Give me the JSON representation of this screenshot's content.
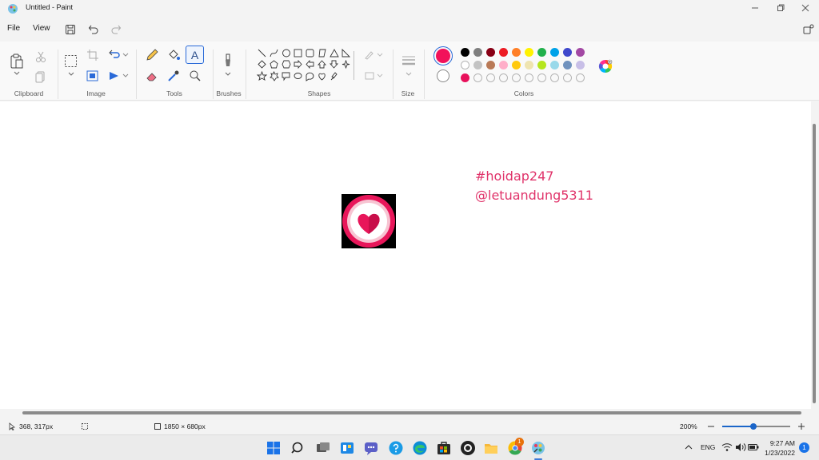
{
  "app": {
    "title": "Untitled - Paint"
  },
  "menu": {
    "file": "File",
    "view": "View"
  },
  "ribbon": {
    "groups": {
      "clipboard": "Clipboard",
      "image": "Image",
      "tools": "Tools",
      "brushes": "Brushes",
      "shapes": "Shapes",
      "size": "Size",
      "colors": "Colors"
    },
    "text_tool_glyph": "A"
  },
  "colors": {
    "primary": "#f2115a",
    "secondary": "#ffffff",
    "palette_row1": [
      "#000000",
      "#7f7f7f",
      "#880015",
      "#ed1c24",
      "#ff7f27",
      "#fff200",
      "#22b14c",
      "#00a2e8",
      "#3f48cc",
      "#a349a4"
    ],
    "palette_row2": [
      "#ffffff",
      "#c3c3c3",
      "#b97a57",
      "#ffaec9",
      "#ffc90e",
      "#efe4b0",
      "#b5e61d",
      "#99d9ea",
      "#7092be",
      "#c8bfe7"
    ],
    "palette_row3": [
      "#e8115b",
      "",
      "",
      "",
      "",
      "",
      "",
      "",
      "",
      ""
    ],
    "text_color": "#e0336a"
  },
  "canvas": {
    "line1": "#hoidap247",
    "line2": "@letuandung5311"
  },
  "status": {
    "cursor": "368, 317px",
    "size": "1850 × 680px",
    "zoom": "200%"
  },
  "taskbar": {
    "lang": "ENG",
    "time": "9:27 AM",
    "date": "1/23/2022",
    "badge": "1"
  }
}
